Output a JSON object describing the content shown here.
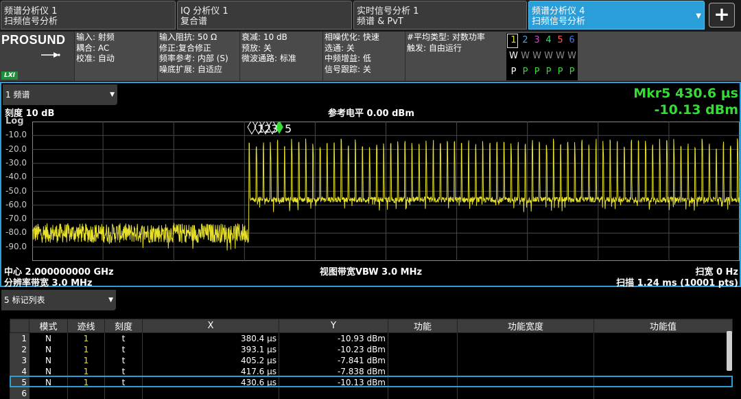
{
  "tabs": [
    {
      "line1": "频谱分析仪 1",
      "line2": "扫频信号分析",
      "active": false
    },
    {
      "line1": "IQ 分析仪 1",
      "line2": "复合谱",
      "active": false
    },
    {
      "line1": "实时信号分析 1",
      "line2": "频谱 & PvT",
      "active": false
    },
    {
      "line1": "频谱分析仪 4",
      "line2": "扫频信号分析",
      "active": true
    }
  ],
  "tab_dropdown_glyph": "▼",
  "add_tab_label": "+",
  "logo": {
    "brand": "PROSUND",
    "badge": "LXI"
  },
  "settings": {
    "col1": [
      "输入: 射频",
      "耦合: AC",
      "校准: 自动"
    ],
    "col2": [
      "输入阻抗: 50 Ω",
      "修正:复合修正",
      "频率参考: 内部 (S)",
      "噪底扩展: 自适应"
    ],
    "col3": [
      "衰减: 10 dB",
      "预放: 关",
      "微波通路: 标准"
    ],
    "col4": [
      "相噪优化: 快速",
      "选通: 关",
      "中频增益: 低",
      "信号跟踪: 关"
    ],
    "col5": [
      "#平均类型: 对数功率",
      "触发: 自由运行"
    ]
  },
  "traces": {
    "numbers": [
      "1",
      "2",
      "3",
      "4",
      "5",
      "6"
    ],
    "number_colors": [
      "#e6e02a",
      "#3fa9f5",
      "#d54cc8",
      "#3fd17a",
      "#ff5a5a",
      "#3f7cf5"
    ],
    "modes": [
      "W",
      "W",
      "W",
      "W",
      "W",
      "W"
    ],
    "dets": [
      "P",
      "P",
      "P",
      "P",
      "P",
      "P"
    ]
  },
  "spectrum": {
    "window_select": "1 频谱",
    "marker_readout_1": "Mkr5  430.6 µs",
    "marker_readout_2": "-10.13 dBm",
    "scale": "刻度 10 dB",
    "scale_type": "Log",
    "ref_level": "参考电平 0.00 dBm",
    "y_ticks": [
      "-10.0",
      "-20.0",
      "-30.0",
      "-40.0",
      "-50.0",
      "-60.0",
      "-70.0",
      "-80.0",
      "-90.0"
    ],
    "marker_labels": "123",
    "active_marker_label": "5",
    "center": "中心 2.000000000 GHz",
    "rbw": "分辨率带宽 3.0 MHz",
    "vbw": "视图带宽VBW 3.0 MHz",
    "span": "扫宽 0 Hz",
    "sweep": "扫描 1.24 ms (10001 pts)",
    "trace_color": "#e6e02a",
    "marker_color": "#33dd33"
  },
  "chart_data": {
    "type": "line",
    "xlabel": "",
    "ylabel": "",
    "xlim": [
      0,
      1.24
    ],
    "ylim": [
      -100,
      0
    ],
    "grid": true,
    "noise_floor_dbm": -80,
    "burst_start_ms": 0.38,
    "burst_on_level_dbm": -10,
    "burst_off_level_dbm": -55,
    "pulse_period_ms": 0.0124,
    "series": [
      {
        "values_description_points": [
          [
            0.0,
            -80
          ],
          [
            0.379,
            -80
          ],
          [
            0.38,
            -10
          ],
          [
            1.24,
            -55
          ]
        ]
      }
    ]
  },
  "marker_table": {
    "window_select": "5 标记列表",
    "columns": [
      "模式",
      "迹线",
      "刻度",
      "X",
      "Y",
      "功能",
      "功能宽度",
      "功能值"
    ],
    "rows": [
      {
        "n": "1",
        "mode": "N",
        "trace": "1",
        "scale": "t",
        "x": "380.4 µs",
        "y": "-10.93 dBm"
      },
      {
        "n": "2",
        "mode": "N",
        "trace": "1",
        "scale": "t",
        "x": "393.1 µs",
        "y": "-10.23 dBm"
      },
      {
        "n": "3",
        "mode": "N",
        "trace": "1",
        "scale": "t",
        "x": "405.2 µs",
        "y": "-7.841 dBm"
      },
      {
        "n": "4",
        "mode": "N",
        "trace": "1",
        "scale": "t",
        "x": "417.6 µs",
        "y": "-7.838 dBm"
      },
      {
        "n": "5",
        "mode": "N",
        "trace": "1",
        "scale": "t",
        "x": "430.6 µs",
        "y": "-10.13 dBm"
      },
      {
        "n": "6",
        "mode": "",
        "trace": "",
        "scale": "",
        "x": "",
        "y": ""
      }
    ]
  }
}
